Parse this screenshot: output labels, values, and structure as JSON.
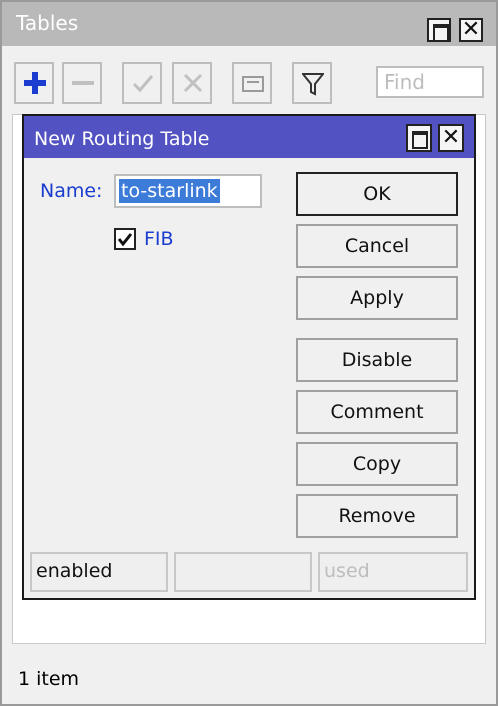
{
  "window": {
    "title": "Tables",
    "find_placeholder": "Find",
    "status": "1 item"
  },
  "dialog": {
    "title": "New Routing Table",
    "name_label": "Name:",
    "name_value": "to-starlink",
    "fib_label": "FIB",
    "fib_checked": true,
    "buttons": [
      "OK",
      "Cancel",
      "Apply",
      "Disable",
      "Comment",
      "Copy",
      "Remove"
    ],
    "status": [
      "enabled",
      "",
      "used"
    ]
  }
}
